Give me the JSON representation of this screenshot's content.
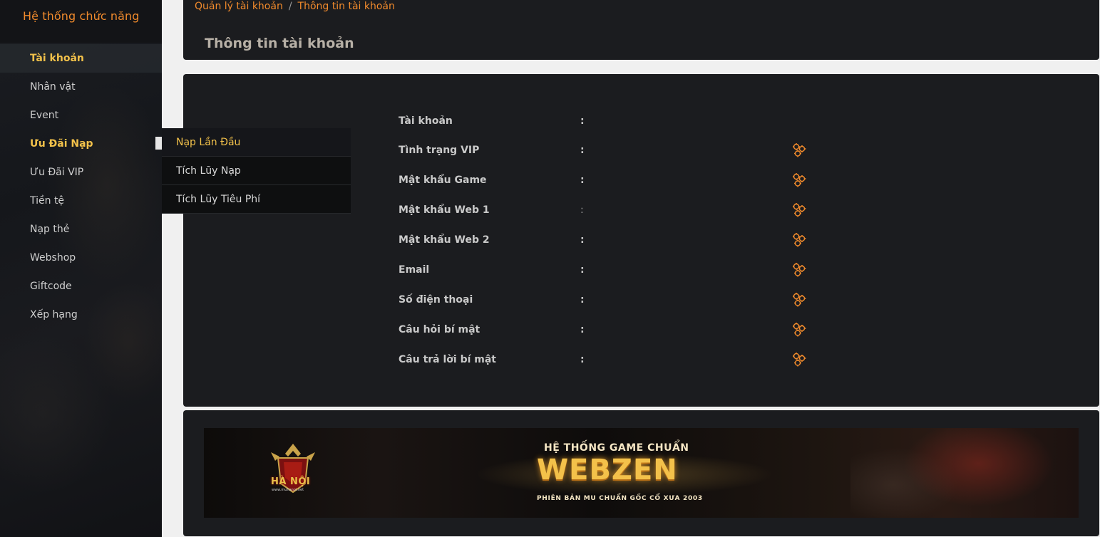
{
  "sidebar": {
    "title": "Hệ thống chức năng",
    "items": [
      {
        "label": "Tài khoản"
      },
      {
        "label": "Nhân vật"
      },
      {
        "label": "Event"
      },
      {
        "label": "Ưu Đãi Nạp"
      },
      {
        "label": "Ưu Đãi VIP"
      },
      {
        "label": "Tiền tệ"
      },
      {
        "label": "Nạp thẻ"
      },
      {
        "label": "Webshop"
      },
      {
        "label": "Giftcode"
      },
      {
        "label": "Xếp hạng"
      }
    ],
    "submenu": [
      {
        "label": "Nạp Lần Đầu"
      },
      {
        "label": "Tích Lũy Nạp"
      },
      {
        "label": "Tích Lũy Tiêu Phí"
      }
    ]
  },
  "breadcrumb": {
    "parent": "Quản lý tài khoản",
    "separator": "/",
    "current": "Thông tin tài khoản"
  },
  "page": {
    "title": "Thông tin tài khoản"
  },
  "info": {
    "colon": ":",
    "rows": [
      {
        "label": "Tài khoản"
      },
      {
        "label": "Tình trạng VIP"
      },
      {
        "label": "Mật khẩu Game"
      },
      {
        "label": "Mật khẩu Web 1"
      },
      {
        "label": "Mật khẩu Web 2"
      },
      {
        "label": "Email"
      },
      {
        "label": "Số điện thoại"
      },
      {
        "label": "Câu hỏi bí mật"
      },
      {
        "label": "Câu trả lời bí mật"
      }
    ],
    "action_icon": "gears-icon"
  },
  "banner": {
    "logo_text": "HÀ NỘI",
    "logo_url": "www.muhanoi.net",
    "subtitle": "HỆ THỐNG GAME CHUẨN",
    "title": "WEBZEN",
    "tagline": "PHIÊN BẢN MU CHUẨN GỐC CỔ XƯA 2003"
  },
  "colors": {
    "accent_orange": "#f08a2c",
    "accent_gold": "#f2c14a",
    "panel_bg": "#1b1c1f"
  }
}
